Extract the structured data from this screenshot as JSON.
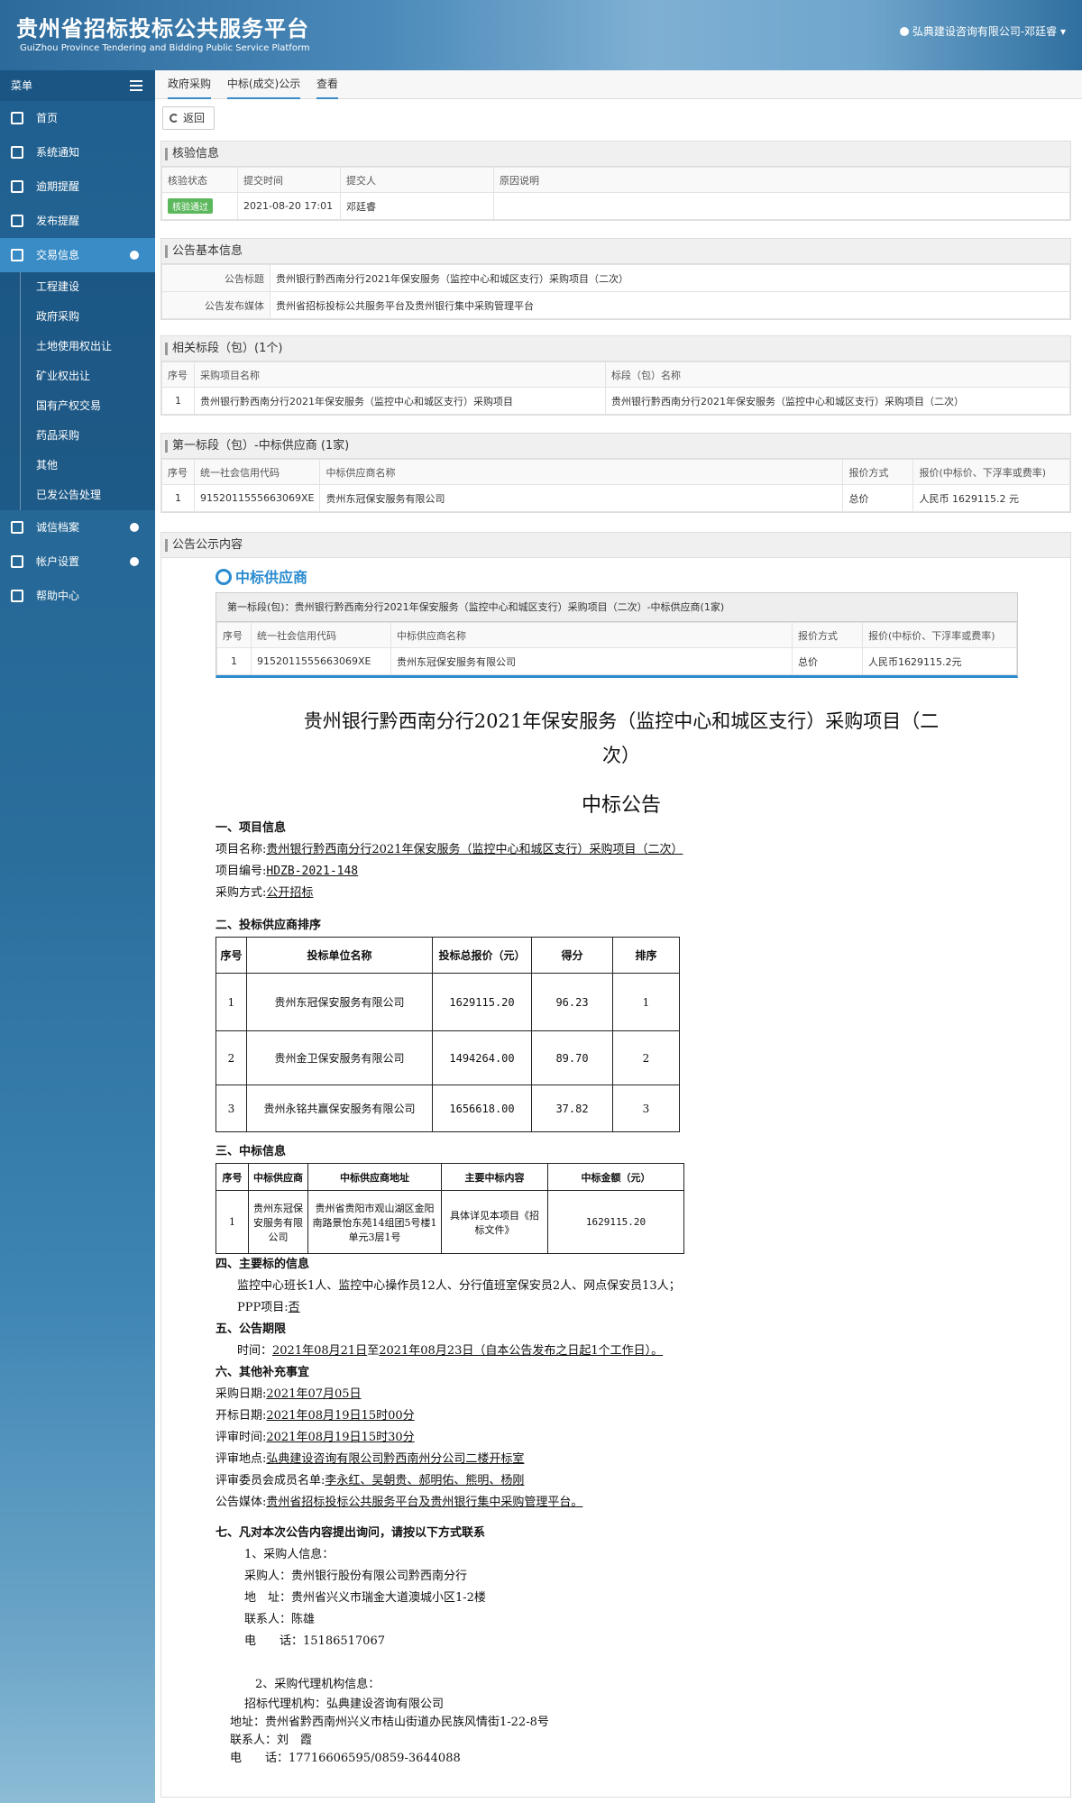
{
  "header": {
    "title_cn": "贵州省招标投标公共服务平台",
    "title_en": "GuiZhou Province Tendering and Bidding Public Service Platform",
    "user": "弘典建设咨询有限公司-邓廷睿"
  },
  "sidebar": {
    "menu_label": "菜单",
    "items": [
      {
        "label": "首页",
        "icon": "home-icon"
      },
      {
        "label": "系统通知",
        "icon": "monitor-icon"
      },
      {
        "label": "逾期提醒",
        "icon": "list-icon"
      },
      {
        "label": "发布提醒",
        "icon": "list-icon"
      },
      {
        "label": "交易信息",
        "icon": "list-icon"
      }
    ],
    "sub_items": [
      "工程建设",
      "政府采购",
      "土地使用权出让",
      "矿业权出让",
      "国有产权交易",
      "药品采购",
      "其他",
      "已发公告处理"
    ],
    "bottom_items": [
      {
        "label": "诚信档案",
        "icon": "table-icon"
      },
      {
        "label": "帐户设置",
        "icon": "user-icon"
      },
      {
        "label": "帮助中心",
        "icon": "help-icon"
      }
    ]
  },
  "breadcrumb": [
    "政府采购",
    "中标(成交)公示",
    "查看"
  ],
  "back_label": "返回",
  "verify": {
    "title": "核验信息",
    "headers": [
      "核验状态",
      "提交时间",
      "提交人",
      "原因说明"
    ],
    "status": "核验通过",
    "time": "2021-08-20 17:01",
    "submitter": "邓廷睿",
    "reason": ""
  },
  "basic": {
    "title": "公告基本信息",
    "rows": [
      {
        "key": "公告标题",
        "value": "贵州银行黔西南分行2021年保安服务（监控中心和城区支行）采购项目（二次）"
      },
      {
        "key": "公告发布媒体",
        "value": "贵州省招标投标公共服务平台及贵州银行集中采购管理平台"
      }
    ]
  },
  "lots": {
    "title": "相关标段（包）(1个)",
    "headers": [
      "序号",
      "采购项目名称",
      "标段（包）名称"
    ],
    "row": [
      "1",
      "贵州银行黔西南分行2021年保安服务（监控中心和城区支行）采购项目",
      "贵州银行黔西南分行2021年保安服务（监控中心和城区支行）采购项目（二次）"
    ]
  },
  "winner": {
    "title": "第一标段（包）-中标供应商 (1家)",
    "headers": [
      "序号",
      "统一社会信用代码",
      "中标供应商名称",
      "报价方式",
      "报价(中标价、下浮率或费率)"
    ],
    "row": [
      "1",
      "9152011555663069XE",
      "贵州东冠保安服务有限公司",
      "总价",
      "人民币 1629115.2 元"
    ]
  },
  "announcement": {
    "title": "公告公示内容",
    "badge": "中标供应商",
    "inner_head": "第一标段(包)：贵州银行黔西南分行2021年保安服务（监控中心和城区支行）采购项目（二次）-中标供应商(1家)",
    "inner_headers": [
      "序号",
      "统一社会信用代码",
      "中标供应商名称",
      "报价方式",
      "报价(中标价、下浮率或费率)"
    ],
    "inner_row": [
      "1",
      "9152011555663069XE",
      "贵州东冠保安服务有限公司",
      "总价",
      "人民币1629115.2元"
    ],
    "doc_title_1": "贵州银行黔西南分行2021年保安服务（监控中心和城区支行）采购项目（二",
    "doc_title_2": "次）",
    "doc_subtitle": "中标公告",
    "s1": "一、项目信息",
    "s1_l1_k": "项目名称:",
    "s1_l1_v": "贵州银行黔西南分行2021年保安服务（监控中心和城区支行）采购项目（二次）",
    "s1_l2_k": "项目编号:",
    "s1_l2_v": "HDZB-2021-148",
    "s1_l3_k": "采购方式:",
    "s1_l3_v": "公开招标",
    "s2": "二、投标供应商排序",
    "rank_headers": [
      "序号",
      "投标单位名称",
      "投标总报价（元）",
      "得分",
      "排序"
    ],
    "rank_rows": [
      [
        "1",
        "贵州东冠保安服务有限公司",
        "1629115.20",
        "96.23",
        "1"
      ],
      [
        "2",
        "贵州金卫保安服务有限公司",
        "1494264.00",
        "89.70",
        "2"
      ],
      [
        "3",
        "贵州永铭共赢保安服务有限公司",
        "1656618.00",
        "37.82",
        "3"
      ]
    ],
    "s3": "三、中标信息",
    "win_headers": [
      "序号",
      "中标供应商",
      "中标供应商地址",
      "主要中标内容",
      "中标金额（元）"
    ],
    "win_row": [
      "1",
      "贵州东冠保安服务有限公司",
      "贵州省贵阳市观山湖区金阳南路景怡东苑14组团5号楼1单元3层1号",
      "具体详见本项目《招标文件》",
      "1629115.20"
    ],
    "s4": "四、主要标的信息",
    "s4_l1": "监控中心班长1人、监控中心操作员12人、分行值班室保安员2人、网点保安员13人；",
    "s4_l2_k": "PPP项目:",
    "s4_l2_v": "否",
    "s5": "五、公告期限",
    "s5_l1_k": "时间：",
    "s5_l1_v": "2021年08月21日",
    "s5_l1_mid": "至",
    "s5_l1_v2": "2021年08月23日（自本公告发布之日起1个工作日）。",
    "s6": "六、其他补充事宜",
    "s6_lines": [
      {
        "k": "采购日期:",
        "v": "2021年07月05日"
      },
      {
        "k": "开标日期:",
        "v": "2021年08月19日15时00分"
      },
      {
        "k": "评审时间:",
        "v": "2021年08月19日15时30分"
      },
      {
        "k": "评审地点:",
        "v": "弘典建设咨询有限公司黔西南州分公司二楼开标室"
      },
      {
        "k": "评审委员会成员名单:",
        "v": "李永红、吴朝贵、郝明佑、熊明、杨刚"
      },
      {
        "k": "公告媒体:",
        "v": "贵州省招标投标公共服务平台及贵州银行集中采购管理平台。"
      }
    ],
    "s7": "七、凡对本次公告内容提出询问，请按以下方式联系",
    "c1_head": "1、采购人信息：",
    "c1_lines": [
      "采购人：贵州银行股份有限公司黔西南分行",
      "地　址：贵州省兴义市瑞金大道澳城小区1-2楼",
      "联系人：陈雄",
      "电　　话：15186517067"
    ],
    "c2_head": "2、采购代理机构信息：",
    "c2_lines": [
      "招标代理机构：弘典建设咨询有限公司",
      "地址：贵州省黔西南州兴义市桔山街道办民族风情街1-22-8号",
      "联系人：刘　霞",
      "电　　话：17716606595/0859-3644088"
    ]
  }
}
